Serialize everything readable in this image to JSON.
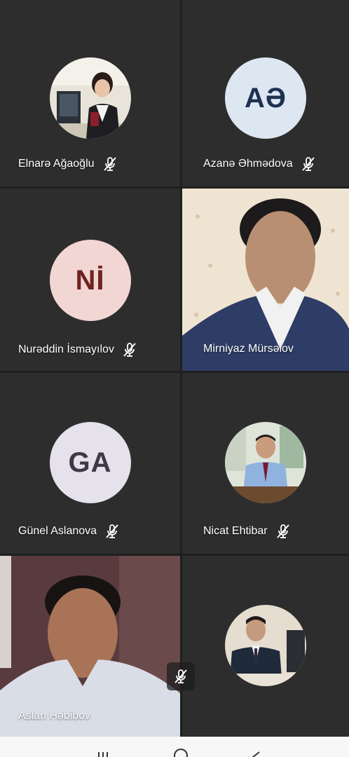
{
  "colors": {
    "tile_bg": "#2d2d2d",
    "gap_bg": "#1f1f1f",
    "name_text": "#ffffff",
    "nav_bg": "#f7f7f7"
  },
  "participants": [
    {
      "name": "Elnarə Ağaoğlu",
      "muted": true,
      "avatar": "photo"
    },
    {
      "name": "Azanə Əhmədova",
      "muted": true,
      "avatar": "initials",
      "initials": "AƏ",
      "avatar_bg": "#dde7f2",
      "initials_color": "#1e3250"
    },
    {
      "name": "Nurəddin İsmayılov",
      "muted": true,
      "avatar": "initials",
      "initials": "Nİ",
      "avatar_bg": "#f2d6d4",
      "initials_color": "#6e2420"
    },
    {
      "name": "Mirniyaz Mürsəlov",
      "muted": false,
      "avatar": "video"
    },
    {
      "name": "Günel Aslanova",
      "muted": true,
      "avatar": "initials",
      "initials": "GA",
      "avatar_bg": "#e5e2ec",
      "initials_color": "#3d3a46"
    },
    {
      "name": "Nicat Ehtibar",
      "muted": true,
      "avatar": "photo"
    },
    {
      "name": "Aslan Həbibov",
      "muted": false,
      "avatar": "video"
    },
    {
      "name": "",
      "muted": false,
      "avatar": "photo"
    }
  ],
  "icons": {
    "mute": "mic-off-icon",
    "nav_recent": "recent-apps-icon",
    "nav_home": "home-icon",
    "nav_back": "back-icon"
  }
}
